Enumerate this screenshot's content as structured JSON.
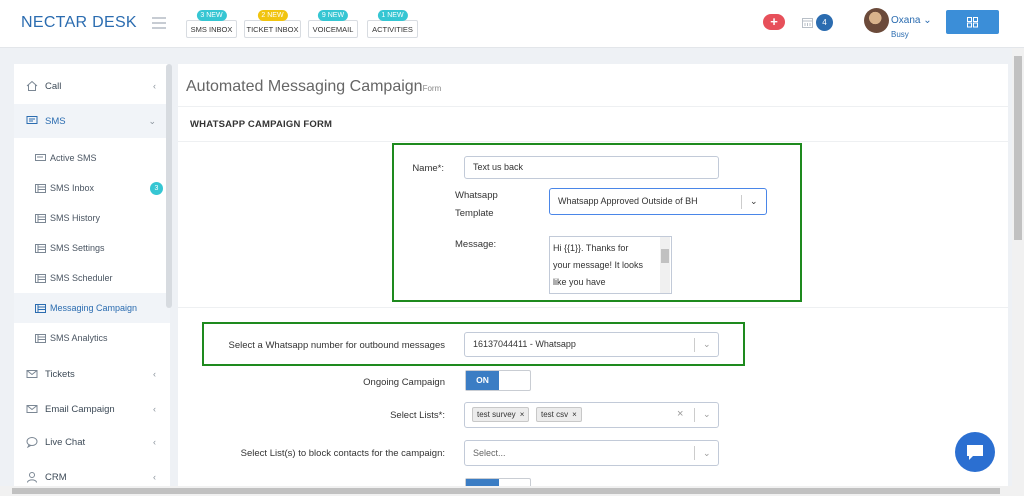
{
  "header": {
    "brand": "NECTAR DESK",
    "inbox_buttons": [
      {
        "label": "SMS INBOX",
        "badge": "3 NEW",
        "badge_color": "#36c6d3"
      },
      {
        "label": "TICKET INBOX",
        "badge": "2 NEW",
        "badge_color": "#f1c40f"
      },
      {
        "label": "VOICEMAIL",
        "badge": "9 NEW",
        "badge_color": "#36c6d3"
      },
      {
        "label": "ACTIVITIES",
        "badge": "1 NEW",
        "badge_color": "#36c6d3"
      }
    ],
    "plus": "+",
    "calendar_count": "4",
    "user_name": "Oxana",
    "user_status": "Busy"
  },
  "sidebar": {
    "items": [
      {
        "label": "Call",
        "icon": "home-icon"
      },
      {
        "label": "SMS",
        "icon": "chat-icon"
      },
      {
        "label": "Tickets",
        "icon": "mail-icon"
      },
      {
        "label": "Email Campaign",
        "icon": "mail-icon"
      },
      {
        "label": "Live Chat",
        "icon": "speech-bubble-icon"
      },
      {
        "label": "CRM",
        "icon": "user-icon"
      }
    ],
    "sms_sub": [
      {
        "label": "Active SMS"
      },
      {
        "label": "SMS Inbox",
        "badge": "3"
      },
      {
        "label": "SMS History"
      },
      {
        "label": "SMS Settings"
      },
      {
        "label": "SMS Scheduler"
      },
      {
        "label": "Messaging Campaign"
      },
      {
        "label": "SMS Analytics"
      }
    ]
  },
  "page": {
    "title": "Automated Messaging Campaign",
    "title_suffix": "Form",
    "section": "WHATSAPP CAMPAIGN FORM"
  },
  "form": {
    "name_label": "Name*:",
    "name_value": "Text us back",
    "template_label_1": "Whatsapp",
    "template_label_2": "Template",
    "template_value": "Whatsapp Approved Outside of BH",
    "message_label": "Message:",
    "message_lines": [
      "Hi {{1}}. Thanks for",
      "your message! It looks",
      "like you have"
    ],
    "number_label": "Select a Whatsapp number for outbound messages",
    "number_value": "16137044411 - Whatsapp",
    "ongoing_label": "Ongoing Campaign",
    "ongoing_value": "ON",
    "lists_label": "Select Lists*:",
    "lists_tags": [
      "test survey",
      "test csv"
    ],
    "block_label": "Select List(s) to block contacts for the campaign:",
    "block_placeholder": "Select..."
  },
  "colors": {
    "brand": "#2b6cb0",
    "highlight_box": "#1e8a1e",
    "toggle_on": "#3b7dc4"
  }
}
